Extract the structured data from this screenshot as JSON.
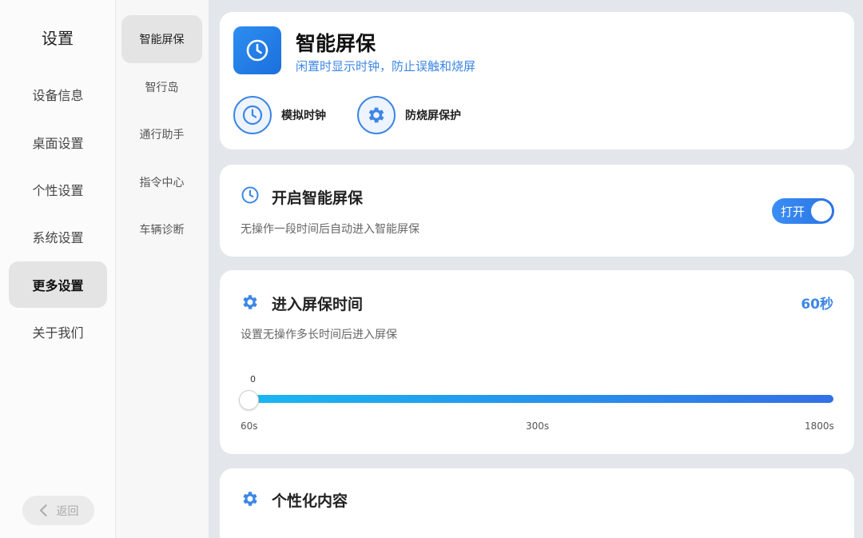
{
  "nav": {
    "title": "设置",
    "items": [
      {
        "label": "设备信息"
      },
      {
        "label": "桌面设置"
      },
      {
        "label": "个性设置"
      },
      {
        "label": "系统设置"
      },
      {
        "label": "更多设置",
        "active": true
      },
      {
        "label": "关于我们"
      }
    ],
    "back_label": "返回"
  },
  "subnav": {
    "items": [
      {
        "label": "智能屏保",
        "active": true
      },
      {
        "label": "智行岛"
      },
      {
        "label": "通行助手"
      },
      {
        "label": "指令中心"
      },
      {
        "label": "车辆诊断"
      }
    ]
  },
  "header": {
    "title": "智能屏保",
    "subtitle": "闲置时显示时钟，防止误触和烧屏",
    "icon": "clock-icon",
    "features": [
      {
        "label": "模拟时钟",
        "icon": "clock-icon"
      },
      {
        "label": "防烧屏保护",
        "icon": "gear-icon"
      }
    ]
  },
  "enable": {
    "title": "开启智能屏保",
    "desc": "无操作一段时间后自动进入智能屏保",
    "toggle_label": "打开",
    "toggle_on": true
  },
  "timeout": {
    "title": "进入屏保时间",
    "value": "60秒",
    "desc": "设置无操作多长时间后进入屏保",
    "slider_current": "0",
    "slider_level": 0,
    "ticks": [
      "60s",
      "300s",
      "1800s"
    ]
  },
  "personal": {
    "title": "个性化内容"
  },
  "colors": {
    "accent": "#3d86e6",
    "slider_start": "#19b8f2",
    "slider_end": "#3370e6"
  }
}
